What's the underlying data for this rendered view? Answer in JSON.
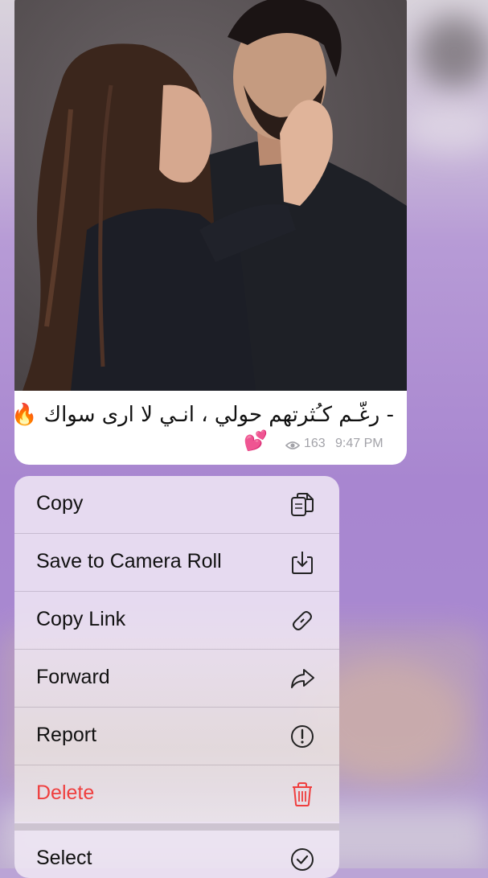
{
  "message": {
    "caption": "- رغّـم كـُثرتهم حولي ، انـي لا ارى سواك 🔥",
    "reaction_emoji": "💕",
    "views": "163",
    "time": "9:47 PM"
  },
  "context_menu": {
    "items": [
      {
        "label": "Copy",
        "icon": "copy-icon"
      },
      {
        "label": "Save to Camera Roll",
        "icon": "save-icon"
      },
      {
        "label": "Copy Link",
        "icon": "link-icon"
      },
      {
        "label": "Forward",
        "icon": "forward-icon"
      },
      {
        "label": "Report",
        "icon": "report-icon"
      },
      {
        "label": "Delete",
        "icon": "trash-icon"
      },
      {
        "label": "Select",
        "icon": "checkmark-icon"
      }
    ]
  },
  "colors": {
    "danger": "#ef3e3e",
    "meta_text": "#a2a2a8",
    "menu_background": "#f0e8f4",
    "chat_background": "#a886d0"
  }
}
